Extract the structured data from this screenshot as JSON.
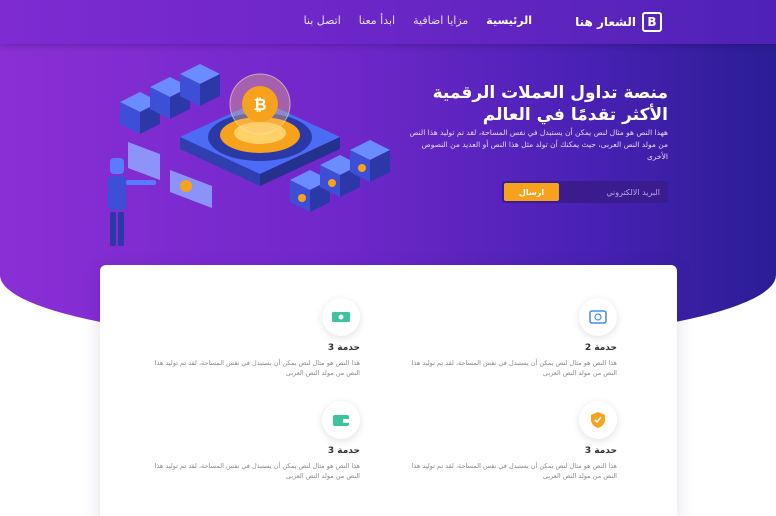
{
  "brand": {
    "logo_letter": "B",
    "name": "الشعار هنا"
  },
  "nav": {
    "items": [
      {
        "label": "الرئيسية",
        "active": true
      },
      {
        "label": "مزايا اضافية",
        "active": false
      },
      {
        "label": "ابدأ معنا",
        "active": false
      },
      {
        "label": "اتصل بنا",
        "active": false
      }
    ]
  },
  "hero": {
    "title_line1": "منصة تداول العملات الرقمية",
    "title_line2": "الأكثر تقدمًا في العالم",
    "description": "ههذا النص هو مثال لنص يمكن أن يستبدل في نفس المساحة، لقد تم توليد هذا النص من مولد النص العربى، حيث يمكنك أن تولد مثل هذا النص أو العديد من النصوص الأخرى",
    "email_placeholder": "البريد الالكتروني",
    "send_label": "ارسال"
  },
  "features": [
    {
      "title": "حدمة 2",
      "desc": "هذا النص هو مثال لنص يمكن أن يستبدل في نفس المساحة، لقد تم توليد هذا النص من مولد النص العربى",
      "icon": "chip-icon"
    },
    {
      "title": "حدمة 3",
      "desc": "هذا النص هو مثال لنص يمكن أن يستبدل في نفس المساحة، لقد تم توليد هذا النص من مولد النص العربى",
      "icon": "cash-icon"
    },
    {
      "title": "حدمة 3",
      "desc": "هذا النص هو مثال لنص يمكن أن يستبدل في نفس المساحة، لقد تم توليد هذا النص من مولد النص العربى",
      "icon": "shield-icon"
    },
    {
      "title": "حدمة 3",
      "desc": "هذا النص هو مثال لنص يمكن أن يستبدل في نفس المساحة، لقد تم توليد هذا النص من مولد النص العربى",
      "icon": "wallet-icon"
    }
  ],
  "colors": {
    "primary": "#6f27c9",
    "accent": "#f6a21c",
    "dark": "#2a1d95"
  }
}
